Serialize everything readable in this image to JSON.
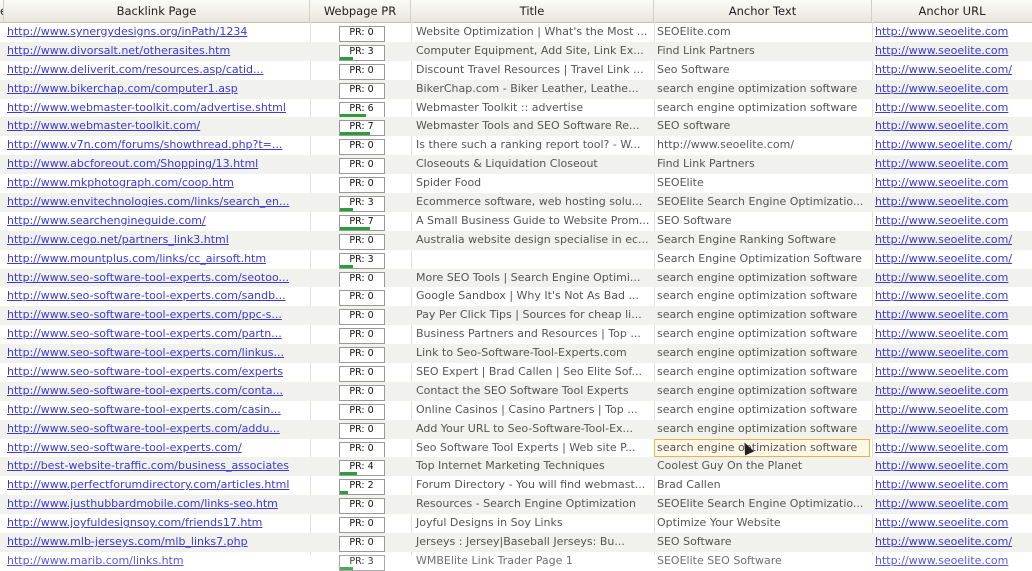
{
  "columns": {
    "stub": "e",
    "backlink": "Backlink Page",
    "pr": "Webpage PR",
    "title": "Title",
    "anchor": "Anchor Text",
    "url": "Anchor URL"
  },
  "pr_bar_max": 10,
  "rows": [
    {
      "backlink": "http://www.synergydesigns.org/inPath/1234",
      "pr_label": "PR: 0",
      "pr": 0,
      "title": "Website Optimization | What's the Most ...",
      "anchor": "SEOElite.com",
      "url": "http://www.seoelite.com"
    },
    {
      "backlink": "http://www.divorsalt.net/otherasites.htm",
      "pr_label": "PR: 3",
      "pr": 3,
      "title": "Computer Equipment, Add Site, Link Ex...",
      "anchor": "Find Link Partners",
      "url": "http://www.seoelite.com"
    },
    {
      "backlink": "http://www.deliverit.com/resources.asp/catid...",
      "pr_label": "PR: 0",
      "pr": 0,
      "title": "Discount Travel Resources | Travel Link ...",
      "anchor": "Seo Software",
      "url": "http://www.seoelite.com/"
    },
    {
      "backlink": "http://www.bikerchap.com/computer1.asp",
      "pr_label": "PR: 0",
      "pr": 0,
      "title": "BikerChap.com - Biker Leather, Leathe...",
      "anchor": "search engine optimization software",
      "url": "http://www.seoelite.com"
    },
    {
      "backlink": "http://www.webmaster-toolkit.com/advertise.shtml",
      "pr_label": "PR: 6",
      "pr": 6,
      "title": "Webmaster Toolkit :: advertise",
      "anchor": "search engine optimization software",
      "url": "http://www.seoelite.com"
    },
    {
      "backlink": "http://www.webmaster-toolkit.com/",
      "pr_label": "PR: 7",
      "pr": 7,
      "title": "Webmaster Tools and SEO Software Re...",
      "anchor": "SEO software",
      "url": "http://www.seoelite.com"
    },
    {
      "backlink": "http://www.v7n.com/forums/showthread.php?t=...",
      "pr_label": "PR: 0",
      "pr": 0,
      "title": "Is there such a ranking report tool? - W...",
      "anchor": "http://www.seoelite.com/",
      "url": "http://www.seoelite.com/"
    },
    {
      "backlink": "http://www.abcforeout.com/Shopping/13.html",
      "pr_label": "PR: 0",
      "pr": 0,
      "title": "Closeouts & Liquidation Closeout",
      "anchor": "Find Link Partners",
      "url": "http://www.seoelite.com"
    },
    {
      "backlink": "http://www.mkphotograph.com/coop.htm",
      "pr_label": "PR: 0",
      "pr": 0,
      "title": "Spider Food",
      "anchor": "SEOElite",
      "url": "http://www.seoelite.com"
    },
    {
      "backlink": "http://www.envitechnologies.com/links/search_en...",
      "pr_label": "PR: 3",
      "pr": 3,
      "title": "Ecommerce software, web hosting solu...",
      "anchor": "SEOElite Search Engine Optimizatio...",
      "url": "http://www.seoelite.com"
    },
    {
      "backlink": "http://www.searchengineguide.com/",
      "pr_label": "PR: 7",
      "pr": 7,
      "title": "A Small Business Guide to Website Prom...",
      "anchor": "SEO Software",
      "url": "http://www.seoelite.com"
    },
    {
      "backlink": "http://www.cego.net/partners_link3.html",
      "pr_label": "PR: 0",
      "pr": 0,
      "title": "Australia website design specialise in ec...",
      "anchor": "Search Engine Ranking Software",
      "url": "http://www.seoelite.com/"
    },
    {
      "backlink": "http://www.mountplus.com/links/cc_airsoft.htm",
      "pr_label": "PR: 3",
      "pr": 3,
      "title": "",
      "anchor": "Search Engine Optimization Software",
      "url": "http://www.seoelite.com/"
    },
    {
      "backlink": "http://www.seo-software-tool-experts.com/seotoo...",
      "pr_label": "PR: 0",
      "pr": 0,
      "title": "More SEO Tools | Search Engine Optimi...",
      "anchor": "search engine optimization software",
      "url": "http://www.seoelite.com"
    },
    {
      "backlink": "http://www.seo-software-tool-experts.com/sandb...",
      "pr_label": "PR: 0",
      "pr": 0,
      "title": "Google Sandbox | Why It's Not As Bad ...",
      "anchor": "search engine optimization software",
      "url": "http://www.seoelite.com"
    },
    {
      "backlink": "http://www.seo-software-tool-experts.com/ppc-s...",
      "pr_label": "PR: 0",
      "pr": 0,
      "title": "Pay Per Click Tips | Sources for cheap li...",
      "anchor": "search engine optimization software",
      "url": "http://www.seoelite.com"
    },
    {
      "backlink": "http://www.seo-software-tool-experts.com/partn...",
      "pr_label": "PR: 0",
      "pr": 0,
      "title": "Business Partners and Resources | Top ...",
      "anchor": "search engine optimization software",
      "url": "http://www.seoelite.com"
    },
    {
      "backlink": "http://www.seo-software-tool-experts.com/linkus...",
      "pr_label": "PR: 0",
      "pr": 0,
      "title": "Link to Seo-Software-Tool-Experts.com",
      "anchor": "search engine optimization software",
      "url": "http://www.seoelite.com"
    },
    {
      "backlink": "http://www.seo-software-tool-experts.com/experts",
      "pr_label": "PR: 0",
      "pr": 0,
      "title": "SEO Expert | Brad Callen | Seo Elite Sof...",
      "anchor": "search engine optimization software",
      "url": "http://www.seoelite.com"
    },
    {
      "backlink": "http://www.seo-software-tool-experts.com/conta...",
      "pr_label": "PR: 0",
      "pr": 0,
      "title": "Contact the SEO Software Tool Experts",
      "anchor": "search engine optimization software",
      "url": "http://www.seoelite.com"
    },
    {
      "backlink": "http://www.seo-software-tool-experts.com/casin...",
      "pr_label": "PR: 0",
      "pr": 0,
      "title": "Online Casinos | Casino Partners | Top ...",
      "anchor": "search engine optimization software",
      "url": "http://www.seoelite.com"
    },
    {
      "backlink": "http://www.seo-software-tool-experts.com/addu...",
      "pr_label": "PR: 0",
      "pr": 0,
      "title": "Add Your URL to Seo-Software-Tool-Ex...",
      "anchor": "search engine optimization software",
      "url": "http://www.seoelite.com"
    },
    {
      "backlink": "http://www.seo-software-tool-experts.com/",
      "pr_label": "PR: 0",
      "pr": 0,
      "title": "Seo Software Tool Experts | Web site P...",
      "anchor": "search engine optimization software",
      "url": "http://www.seoelite.com",
      "selected": true
    },
    {
      "backlink": "http://best-website-traffic.com/business_associates",
      "pr_label": "PR: 4",
      "pr": 4,
      "title": "Top Internet Marketing Techniques",
      "anchor": "Coolest Guy On the Planet",
      "url": "http://www.seoelite.com"
    },
    {
      "backlink": "http://www.perfectforumdirectory.com/articles.html",
      "pr_label": "PR: 2",
      "pr": 2,
      "title": "Forum Directory - You will find webmast...",
      "anchor": "Brad Callen",
      "url": "http://www.seoelite.com"
    },
    {
      "backlink": "http://www.justhubbardmobile.com/links-seo.htm",
      "pr_label": "PR: 0",
      "pr": 0,
      "title": "Resources - Search Engine Optimization",
      "anchor": "SEOElite Search Engine Optimizatio...",
      "url": "http://www.seoelite.com"
    },
    {
      "backlink": "http://www.joyfuldesignsoy.com/friends17.htm",
      "pr_label": "PR: 0",
      "pr": 0,
      "title": "Joyful Designs in Soy Links",
      "anchor": "Optimize Your Website",
      "url": "http://www.seoelite.com"
    },
    {
      "backlink": "http://www.mlb-jerseys.com/mlb_links7.php",
      "pr_label": "PR: 0",
      "pr": 0,
      "title": "Jerseys : Jersey|Baseball Jerseys: Bu...",
      "anchor": "SEO Software",
      "url": "http://www.seoelite.com/"
    },
    {
      "backlink": "http://www.marib.com/links.htm",
      "pr_label": "PR: 3",
      "pr": 3,
      "title": "WMBElite Link Trader Page 1",
      "anchor": "SEOElite SEO Software",
      "url": "http://www.seoelite.com"
    }
  ]
}
